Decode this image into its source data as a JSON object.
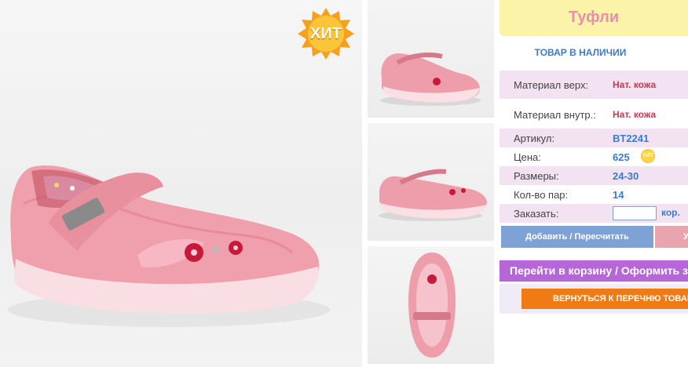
{
  "product": {
    "title": "Туфли",
    "stock_status": "ТОВАР В НАЛИЧИИ",
    "hit_badge": "ХИТ",
    "small_hit_badge": "ХИТ"
  },
  "details": [
    {
      "label": "Материал верх:",
      "value": "Нат. кожа"
    },
    {
      "label": "Материал внутр.:",
      "value": "Нат. кожа"
    },
    {
      "label": "Артикул:",
      "value": "BT2241"
    },
    {
      "label": "Цена:",
      "value": "625"
    },
    {
      "label": "Размеры:",
      "value": "24-30"
    },
    {
      "label": "Кол-во пар:",
      "value": "14"
    }
  ],
  "order": {
    "label": "Заказать:",
    "qty_value": "",
    "unit": "кор."
  },
  "buttons": {
    "add": "Добавить / Пересчитать",
    "delete": "Удалить",
    "cart": "Перейти в корзину / Оформить заказ",
    "back": "ВЕРНУТЬСЯ К ПЕРЕЧНЮ ТОВАРОВ"
  },
  "colors": {
    "title_bg": "#fbf3a8",
    "accent_pink": "#ea8eb0",
    "blue": "#3b7bc8",
    "purple": "#b567d8",
    "orange": "#f07b14"
  },
  "icons": [
    "hit-starburst",
    "shoe-photo",
    "shoe-thumbnail",
    "arrow-left"
  ]
}
